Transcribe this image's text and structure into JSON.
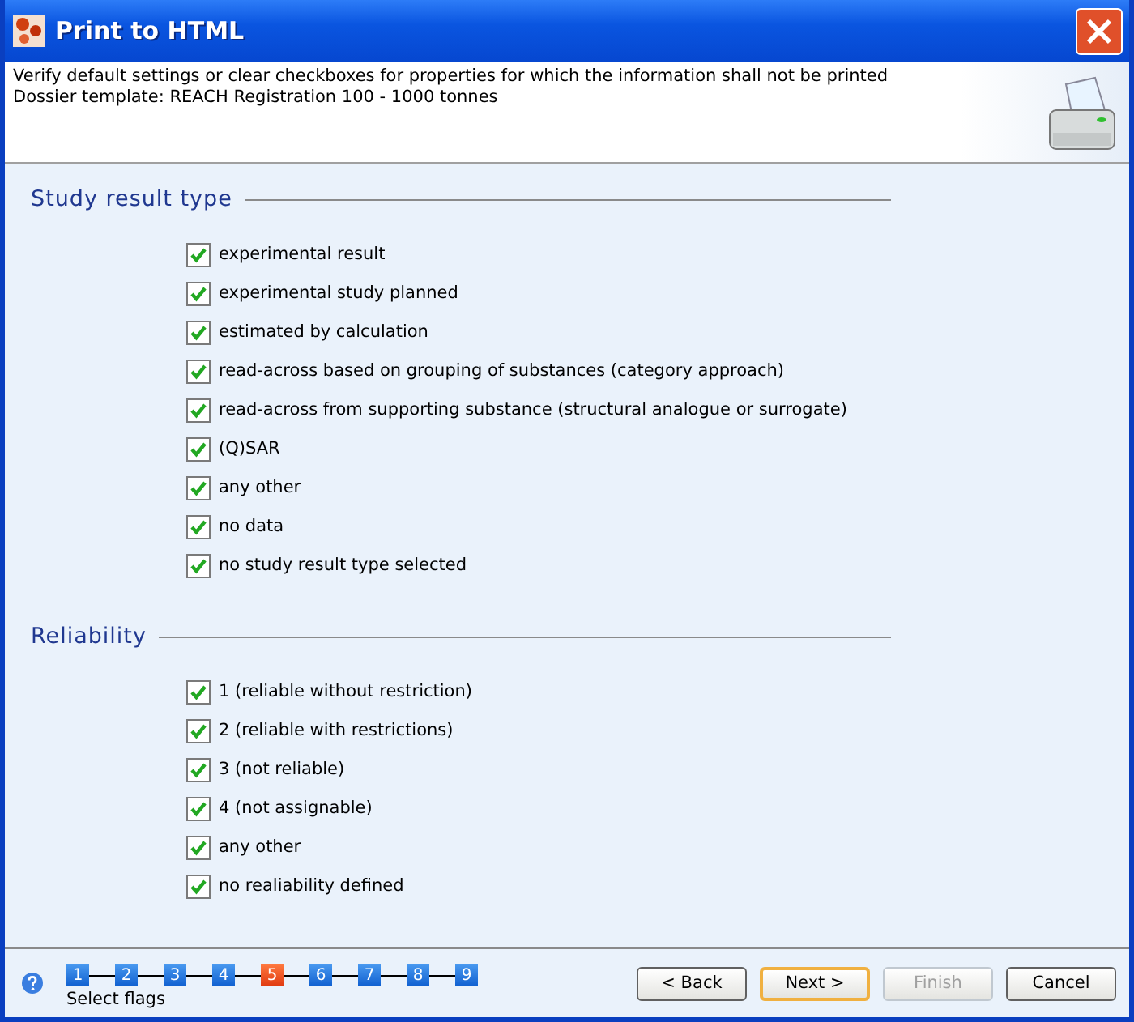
{
  "window": {
    "title": "Print to HTML"
  },
  "header": {
    "lines": [
      "Verify default settings or clear checkboxes for properties for which the information shall not be printed",
      "Dossier template: REACH Registration 100 - 1000 tonnes"
    ]
  },
  "sections": [
    {
      "title": "Study result type",
      "options": [
        {
          "label": "experimental result",
          "checked": true
        },
        {
          "label": "experimental study planned",
          "checked": true
        },
        {
          "label": "estimated by calculation",
          "checked": true
        },
        {
          "label": "read-across based on grouping of substances (category approach)",
          "checked": true
        },
        {
          "label": "read-across from supporting substance (structural analogue or surrogate)",
          "checked": true
        },
        {
          "label": "(Q)SAR",
          "checked": true
        },
        {
          "label": "any other",
          "checked": true
        },
        {
          "label": "no data",
          "checked": true
        },
        {
          "label": "no study result type selected",
          "checked": true
        }
      ]
    },
    {
      "title": "Reliability",
      "options": [
        {
          "label": "1 (reliable without restriction)",
          "checked": true
        },
        {
          "label": "2 (reliable with restrictions)",
          "checked": true
        },
        {
          "label": "3 (not reliable)",
          "checked": true
        },
        {
          "label": "4 (not assignable)",
          "checked": true
        },
        {
          "label": "any other",
          "checked": true
        },
        {
          "label": "no realiability defined",
          "checked": true
        }
      ]
    }
  ],
  "steps": [
    {
      "label": "1",
      "selected": false
    },
    {
      "label": "2",
      "selected": false
    },
    {
      "label": "3",
      "selected": false
    },
    {
      "label": "4",
      "selected": false
    },
    {
      "label": "5",
      "selected": true
    },
    {
      "label": "6",
      "selected": false
    },
    {
      "label": "7",
      "selected": false
    },
    {
      "label": "8",
      "selected": false
    },
    {
      "label": "9",
      "selected": false
    }
  ],
  "step_caption": "Select flags",
  "buttons": [
    {
      "label": "< Back",
      "disabled": false,
      "default": false
    },
    {
      "label": "Next >",
      "disabled": false,
      "default": true
    },
    {
      "label": "Finish",
      "disabled": true,
      "default": false
    },
    {
      "label": "Cancel",
      "disabled": false,
      "default": false
    }
  ]
}
